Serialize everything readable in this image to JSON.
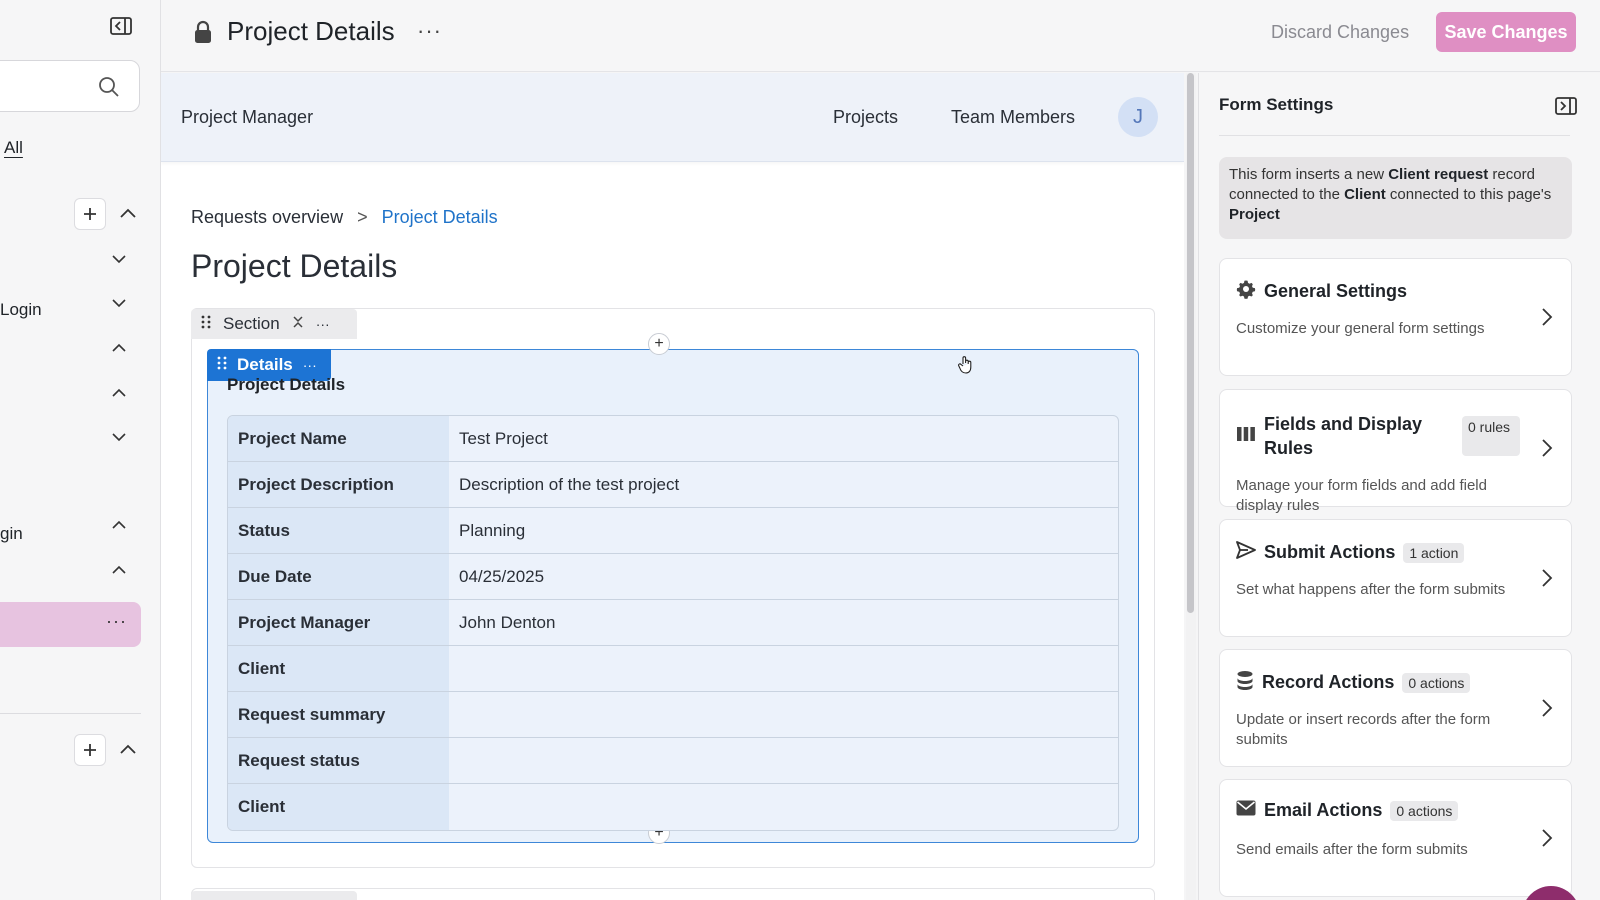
{
  "sidebar": {
    "tab_all": "All",
    "items": [
      {
        "label": "Login"
      },
      {
        "label": "gin"
      }
    ],
    "active_item_more": "···"
  },
  "header": {
    "title": "Project Details",
    "more": "···",
    "discard_label": "Discard Changes",
    "save_label": "Save Changes"
  },
  "preview": {
    "navbar": {
      "brand": "Project Manager",
      "links": [
        "Projects",
        "Team Members"
      ],
      "avatar_initial": "J"
    },
    "breadcrumb": {
      "parent": "Requests overview",
      "separator": ">",
      "current": "Project Details"
    },
    "page_title": "Project Details",
    "section_label": "Section",
    "details_label": "Details",
    "details_heading": "Project Details",
    "fields": [
      {
        "label": "Project Name",
        "value": "Test Project"
      },
      {
        "label": "Project Description",
        "value": "Description of the test project"
      },
      {
        "label": "Status",
        "value": "Planning"
      },
      {
        "label": "Due Date",
        "value": "04/25/2025"
      },
      {
        "label": "Project Manager",
        "value": "John Denton"
      },
      {
        "label": "Client",
        "value": ""
      },
      {
        "label": "Request summary",
        "value": ""
      },
      {
        "label": "Request status",
        "value": ""
      },
      {
        "label": "Client",
        "value": ""
      }
    ]
  },
  "form_settings": {
    "title": "Form Settings",
    "info": {
      "t1": "This form inserts a new ",
      "b1": "Client request",
      "t2": " record connected to the ",
      "b2": "Client",
      "t3": " connected to this page's ",
      "b3": "Project"
    },
    "cards": [
      {
        "title": "General Settings",
        "badge": "",
        "desc": "Customize your general form settings",
        "icon": "gear-icon"
      },
      {
        "title": "Fields and Display Rules",
        "badge": "0 rules",
        "desc": "Manage your form fields and add field display rules",
        "icon": "columns-icon"
      },
      {
        "title": "Submit Actions",
        "badge": "1 action",
        "desc": "Set what happens after the form submits",
        "icon": "send-icon"
      },
      {
        "title": "Record Actions",
        "badge": "0 actions",
        "desc": "Update or insert records after the form submits",
        "icon": "database-icon"
      },
      {
        "title": "Email Actions",
        "badge": "0 actions",
        "desc": "Send emails after the form submits",
        "icon": "mail-icon"
      }
    ]
  },
  "colors": {
    "primary": "#1d74d4",
    "save_button": "#df8fc3",
    "active_sidebar": "#e7c3e0",
    "details_bg": "#e9f1fb"
  }
}
